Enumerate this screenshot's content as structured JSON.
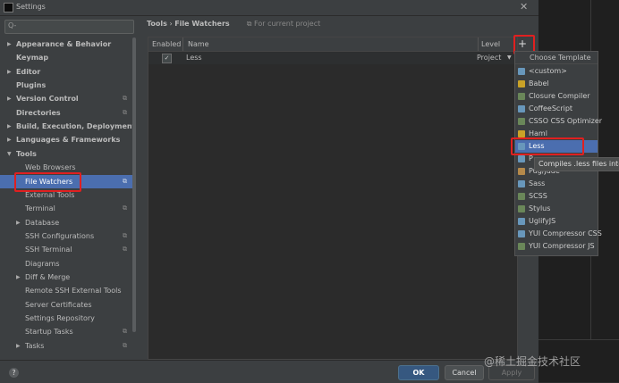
{
  "window": {
    "title": "Settings"
  },
  "search": {
    "placeholder": "Q-"
  },
  "sidebar": {
    "items": [
      {
        "label": "Appearance & Behavior"
      },
      {
        "label": "Keymap"
      },
      {
        "label": "Editor"
      },
      {
        "label": "Plugins"
      },
      {
        "label": "Version Control"
      },
      {
        "label": "Directories"
      },
      {
        "label": "Build, Execution, Deployment"
      },
      {
        "label": "Languages & Frameworks"
      },
      {
        "label": "Tools"
      },
      {
        "label": "Web Browsers"
      },
      {
        "label": "File Watchers"
      },
      {
        "label": "External Tools"
      },
      {
        "label": "Terminal"
      },
      {
        "label": "Database"
      },
      {
        "label": "SSH Configurations"
      },
      {
        "label": "SSH Terminal"
      },
      {
        "label": "Diagrams"
      },
      {
        "label": "Diff & Merge"
      },
      {
        "label": "Remote SSH External Tools"
      },
      {
        "label": "Server Certificates"
      },
      {
        "label": "Settings Repository"
      },
      {
        "label": "Startup Tasks"
      },
      {
        "label": "Tasks"
      }
    ]
  },
  "breadcrumb": {
    "parent": "Tools",
    "separator": "›",
    "current": "File Watchers",
    "scope": "For current project"
  },
  "table": {
    "headers": {
      "enabled": "Enabled",
      "name": "Name",
      "level": "Level"
    },
    "rows": [
      {
        "enabled": "✓",
        "name": "Less",
        "level": "Project"
      }
    ]
  },
  "add_button": {
    "label": "+"
  },
  "template_menu": {
    "title": "Choose Template",
    "items": [
      {
        "label": "<custom>",
        "icon": "custom-icon",
        "color": "#6897bb"
      },
      {
        "label": "Babel",
        "icon": "babel-icon",
        "color": "#c9a227"
      },
      {
        "label": "Closure Compiler",
        "icon": "closure-icon",
        "color": "#6a8759"
      },
      {
        "label": "CoffeeScript",
        "icon": "coffeescript-icon",
        "color": "#6897bb"
      },
      {
        "label": "CSSO CSS Optimizer",
        "icon": "csso-icon",
        "color": "#6a8759"
      },
      {
        "label": "Haml",
        "icon": "haml-icon",
        "color": "#c9a227"
      },
      {
        "label": "Less",
        "icon": "less-icon",
        "color": "#6897bb"
      },
      {
        "label": "P",
        "icon": "p-icon",
        "color": "#6897bb"
      },
      {
        "label": "Pug/Jade",
        "icon": "pug-icon",
        "color": "#b5894a"
      },
      {
        "label": "Sass",
        "icon": "sass-icon",
        "color": "#6897bb"
      },
      {
        "label": "SCSS",
        "icon": "scss-icon",
        "color": "#6a8759"
      },
      {
        "label": "Stylus",
        "icon": "stylus-icon",
        "color": "#6a8759"
      },
      {
        "label": "UglifyJS",
        "icon": "uglifyjs-icon",
        "color": "#6897bb"
      },
      {
        "label": "YUI Compressor CSS",
        "icon": "yui-css-icon",
        "color": "#6897bb"
      },
      {
        "label": "YUI Compressor JS",
        "icon": "yui-js-icon",
        "color": "#6a8759"
      }
    ]
  },
  "tooltip": {
    "text": "Compiles .less files into .c"
  },
  "footer": {
    "help": "?",
    "ok": "OK",
    "cancel": "Cancel",
    "apply": "Apply"
  },
  "watermark": {
    "text": "@稀土掘金技术社区"
  },
  "colors": {
    "selection": "#4b6eaf",
    "highlight_box": "#e02020",
    "ok_button": "#365880"
  }
}
